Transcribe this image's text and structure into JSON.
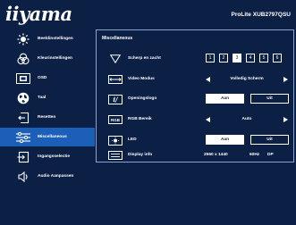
{
  "header": {
    "logo": "iiyama",
    "model": "ProLite XUB2797QSU"
  },
  "sidebar": {
    "items": [
      {
        "label": "Beeldinstellingen",
        "icon": "brightness-icon"
      },
      {
        "label": "Kleurinstellingen",
        "icon": "color-icon"
      },
      {
        "label": "OSD",
        "icon": "osd-icon"
      },
      {
        "label": "Taal",
        "icon": "globe-icon"
      },
      {
        "label": "Resetten",
        "icon": "reset-icon"
      },
      {
        "label": "Miscellaneous",
        "icon": "settings-icon",
        "active": true
      },
      {
        "label": "Ingangsselectie",
        "icon": "input-icon"
      },
      {
        "label": "Audio Aanpassen",
        "icon": "speaker-icon"
      }
    ]
  },
  "panel": {
    "title": "Miscellaneous",
    "sharpness": {
      "label": "Scherp en zacht",
      "options": [
        "1",
        "2",
        "3",
        "4",
        "5",
        "6"
      ],
      "selected": "3"
    },
    "video_mode": {
      "label": "Video Modus",
      "value": "Volledig Scherm"
    },
    "opening_logo": {
      "label": "Openingslogo",
      "on": "Aan",
      "off": "Uit",
      "selected": "on"
    },
    "rgb_range": {
      "label": "RGB Bereik",
      "value": "Auto"
    },
    "led": {
      "label": "LED",
      "on": "Aan",
      "off": "Uit",
      "selected": "on"
    },
    "display_info": {
      "label": "Display info",
      "resolution": "2560 x 1440",
      "refresh": "60Hz",
      "port": "DP"
    }
  },
  "colors": {
    "background": "#0c1f44",
    "active": "#1c5fb8",
    "border": "#8aa4d0"
  }
}
